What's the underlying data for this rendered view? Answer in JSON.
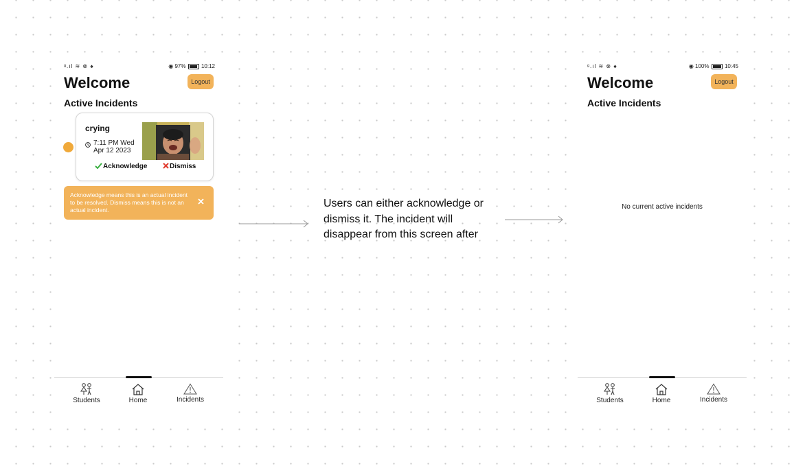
{
  "left_screen": {
    "status_left": "ᵍ.ıl ≋ ⊗ ♠",
    "status_right_prefix": "◉ 97%",
    "battery_level": 0.97,
    "time": "10:12",
    "title": "Welcome",
    "logout_label": "Logout",
    "section_title": "Active Incidents",
    "incident": {
      "title": "crying",
      "time": "7:11 PM Wed Apr 12 2023",
      "acknowledge_label": "Acknowledge",
      "dismiss_label": "Dismiss"
    },
    "banner_text": "Acknowledge means this is an actual incident to be resolved. Dismiss means this is not an actual incident."
  },
  "right_screen": {
    "status_left": "ᵍ.ıl ≋ ⊗ ♠",
    "status_right_prefix": "◉ 100%",
    "battery_level": 1.0,
    "time": "10:45",
    "title": "Welcome",
    "logout_label": "Logout",
    "section_title": "Active Incidents",
    "empty_message": "No current active incidents"
  },
  "nav": {
    "students_label": "Students",
    "home_label": "Home",
    "incidents_label": "Incidents",
    "active_tab": "Home"
  },
  "explanation": "Users can either acknowledge or dismiss it. The incident will disappear from this screen after",
  "colors": {
    "accent": "#f2b35a",
    "indicator_dot": "#f0a93a",
    "acknowledge": "#3cb043",
    "dismiss": "#e03b2e"
  },
  "icons": [
    "clock-icon",
    "checkmark-icon",
    "x-icon",
    "close-icon",
    "students-icon",
    "home-icon",
    "warning-icon",
    "battery-icon",
    "arrow-right-icon"
  ]
}
